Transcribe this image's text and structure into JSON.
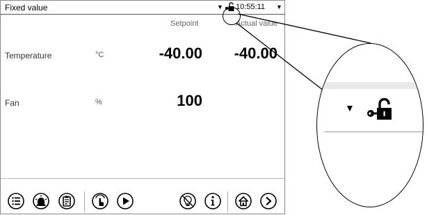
{
  "titlebar": {
    "title": "Fixed value",
    "dropdown_glyph": "▼",
    "lock_icon": "unlock-key-icon",
    "time": "10:55:11",
    "menu_glyph": "▼"
  },
  "columns": {
    "setpoint": "Setpoint",
    "actual": "Actual value"
  },
  "rows": [
    {
      "label": "Temperature",
      "unit": "°C",
      "setpoint": "-40.00",
      "actual": "-40.00"
    },
    {
      "label": "Fan",
      "unit": "%",
      "setpoint": "100",
      "actual": ""
    }
  ],
  "toolbar": {
    "icons": [
      "list-icon",
      "alarm-icon",
      "clipboard-icon",
      "touch-icon",
      "play-icon",
      "light-off-icon",
      "info-icon",
      "home-icon",
      "next-icon"
    ]
  },
  "magnifier": {
    "chevron": "▼",
    "lock_icon": "unlock-key-icon"
  }
}
